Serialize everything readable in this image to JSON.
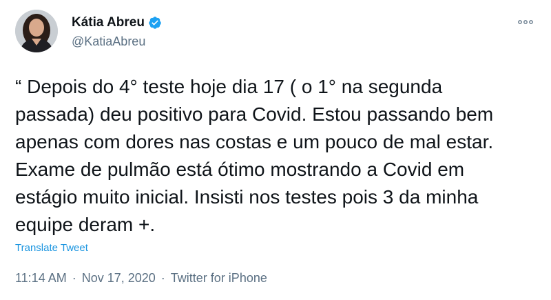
{
  "author": {
    "name": "Kátia Abreu",
    "handle": "@KatiaAbreu",
    "verified": true,
    "avatar_icon": "profile-photo"
  },
  "tweet": {
    "text": "“ Depois do 4° teste hoje dia 17 ( o 1° na segunda\npassada) deu positivo para Covid. Estou passando bem\napenas com dores nas costas e um pouco de mal estar.\nExame de pulmão está ótimo mostrando a Covid em\nestágio muito inicial. Insisti nos testes pois 3 da minha\nequipe deram +.",
    "translate_label": "Translate Tweet"
  },
  "meta": {
    "time": "11:14 AM",
    "separator": "·",
    "date": "Nov 17, 2020",
    "source": "Twitter for iPhone"
  },
  "colors": {
    "text": "#0f1419",
    "secondary": "#5b7083",
    "link": "#1b95e0",
    "verified": "#1da1f2"
  }
}
